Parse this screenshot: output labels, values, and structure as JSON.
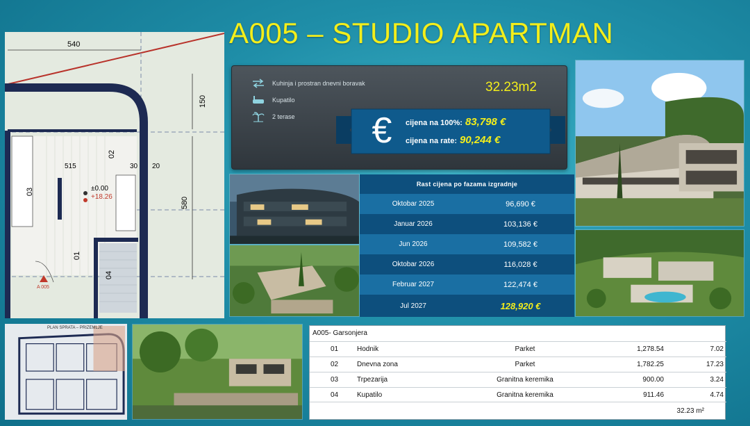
{
  "title": "A005 – STUDIO  APARTMAN",
  "floor_plan": {
    "dim_top": "540",
    "dim_right_top": "150",
    "dim_right": "580",
    "dim_inner": "515",
    "dim_inner2": "30",
    "dim_inner3": "20",
    "room_02": "02",
    "room_03": "03",
    "room_01": "01",
    "room_04": "04",
    "level_1": "±0.00",
    "level_2": "+18.26",
    "unit_mark": "A 005"
  },
  "features": [
    {
      "icon": "arrows-icon",
      "label": "Kuhinja i prostran dnevni boravak"
    },
    {
      "icon": "bathtub-icon",
      "label": "Kupatilo"
    },
    {
      "icon": "palm-icon",
      "label": "2 terase"
    }
  ],
  "area": "32.23m2",
  "price": {
    "currency_symbol": "€",
    "full_label": "cijena  na 100%:",
    "full_value": "83,798 €",
    "rate_label": "cijena  na rate:",
    "rate_value": "90,244 €"
  },
  "growth": {
    "title": "Rast cijena po fazama izgradnje",
    "rows": [
      {
        "date": "Oktobar 2025",
        "price": "96,690 €"
      },
      {
        "date": "Januar 2026",
        "price": "103,136 €"
      },
      {
        "date": "Jun 2026",
        "price": "109,582 €"
      },
      {
        "date": "Oktobar 2026",
        "price": "116,028 €"
      },
      {
        "date": "Februar 2027",
        "price": "122,474 €"
      },
      {
        "date": "Jul 2027",
        "price": "128,920 €"
      }
    ]
  },
  "site_plan": {
    "label": "PLAN SPRATA – PRIZEMLJE"
  },
  "rooms_table": {
    "title": "A005- Garsonjera",
    "rows": [
      {
        "no": "01",
        "name": "Hodnik",
        "material": "Parket",
        "value": "1,278.54",
        "area": "7.02"
      },
      {
        "no": "02",
        "name": "Dnevna zona",
        "material": "Parket",
        "value": "1,782.25",
        "area": "17.23"
      },
      {
        "no": "03",
        "name": "Trpezarija",
        "material": "Granitna keremika",
        "value": "900.00",
        "area": "3.24"
      },
      {
        "no": "04",
        "name": "Kupatilo",
        "material": "Granitna keremika",
        "value": "911.46",
        "area": "4.74"
      }
    ],
    "total": "32.23 m²"
  },
  "colors": {
    "accent_yellow": "#f3ee1b",
    "background_teal": "#1f8ea8",
    "ribbon_blue": "#0d4f7d"
  }
}
